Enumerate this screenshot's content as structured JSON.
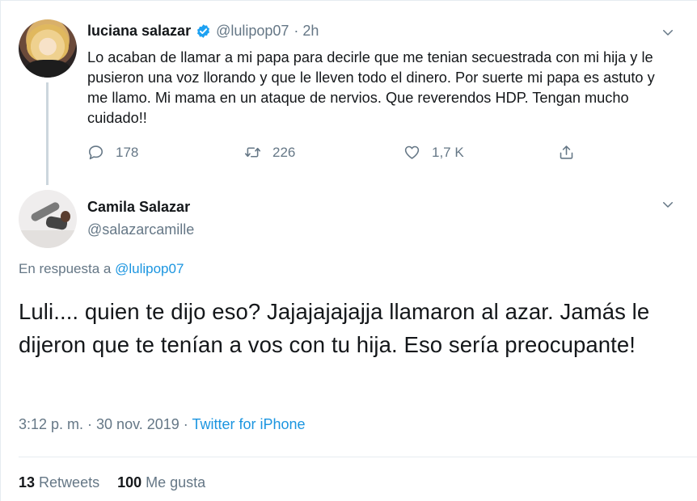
{
  "tweet1": {
    "name": "luciana salazar",
    "handle": "@lulipop07",
    "time": "· 2h",
    "text": "Lo acaban de llamar a mi papa para decirle que me tenian secuestrada con mi hija y le pusieron una voz llorando y que le lleven todo el dinero. Por suerte mi papa es astuto y me llamo. Mi mama en un ataque de nervios. Que reverendos HDP. Tengan mucho cuidado!!",
    "replies": "178",
    "retweets": "226",
    "likes": "1,7 K"
  },
  "tweet2": {
    "name": "Camila Salazar",
    "handle": "@salazarcamille",
    "reply_prefix": "En respuesta a",
    "reply_mention": "@lulipop07",
    "text": "Luli.... quien te dijo eso? Jajajajajajja llamaron al azar. Jamás le dijeron que te tenían a vos con tu hija. Eso sería preocupante!",
    "timestamp": "3:12 p. m. · 30 nov. 2019 ·",
    "source": "Twitter for iPhone",
    "retweet_count": "13",
    "retweet_label": "Retweets",
    "like_count": "100",
    "like_label": "Me gusta"
  },
  "colors": {
    "text": "#14171a",
    "secondary": "#657786",
    "link": "#1b95e0",
    "verified": "#1da1f2",
    "divider": "#e6ecf0"
  },
  "icons": [
    "verified-badge-icon",
    "chevron-down-icon",
    "reply-icon",
    "retweet-icon",
    "heart-icon",
    "share-icon"
  ]
}
